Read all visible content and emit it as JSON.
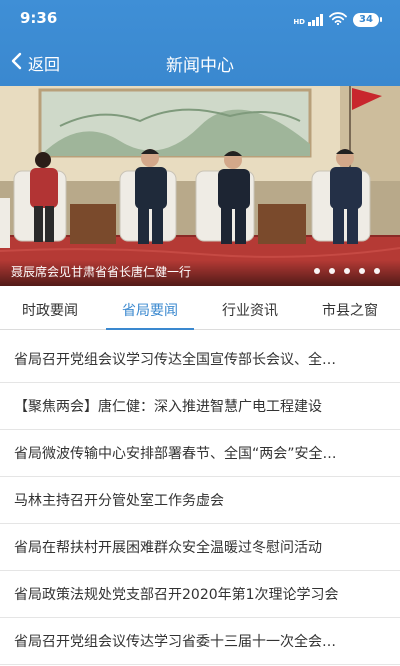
{
  "status_bar": {
    "time": "9:36",
    "signal_label": "HD",
    "battery": "34",
    "icons": [
      "signal-icon",
      "wifi-icon",
      "battery-icon"
    ]
  },
  "nav": {
    "back_label": "返回",
    "title": "新闻中心"
  },
  "banner": {
    "caption": "聂辰席会见甘肃省省长唐仁健一行",
    "slide_count": 5
  },
  "tabs": [
    {
      "label": "时政要闻",
      "active": false
    },
    {
      "label": "省局要闻",
      "active": true
    },
    {
      "label": "行业资讯",
      "active": false
    },
    {
      "label": "市县之窗",
      "active": false
    }
  ],
  "news": [
    {
      "title": "省局召开党组会议学习传达全国宣传部长会议、全…"
    },
    {
      "title": "【聚焦两会】唐仁健：深入推进智慧广电工程建设"
    },
    {
      "title": "省局微波传输中心安排部署春节、全国“两会”安全…"
    },
    {
      "title": "马林主持召开分管处室工作务虚会"
    },
    {
      "title": "省局在帮扶村开展困难群众安全温暖过冬慰问活动"
    },
    {
      "title": "省局政策法规处党支部召开2020年第1次理论学习会"
    },
    {
      "title": "省局召开党组会议传达学习省委十三届十一次全会…"
    }
  ],
  "colors": {
    "primary": "#3a88cf",
    "text": "#333333",
    "divider": "#e5e5e5"
  }
}
